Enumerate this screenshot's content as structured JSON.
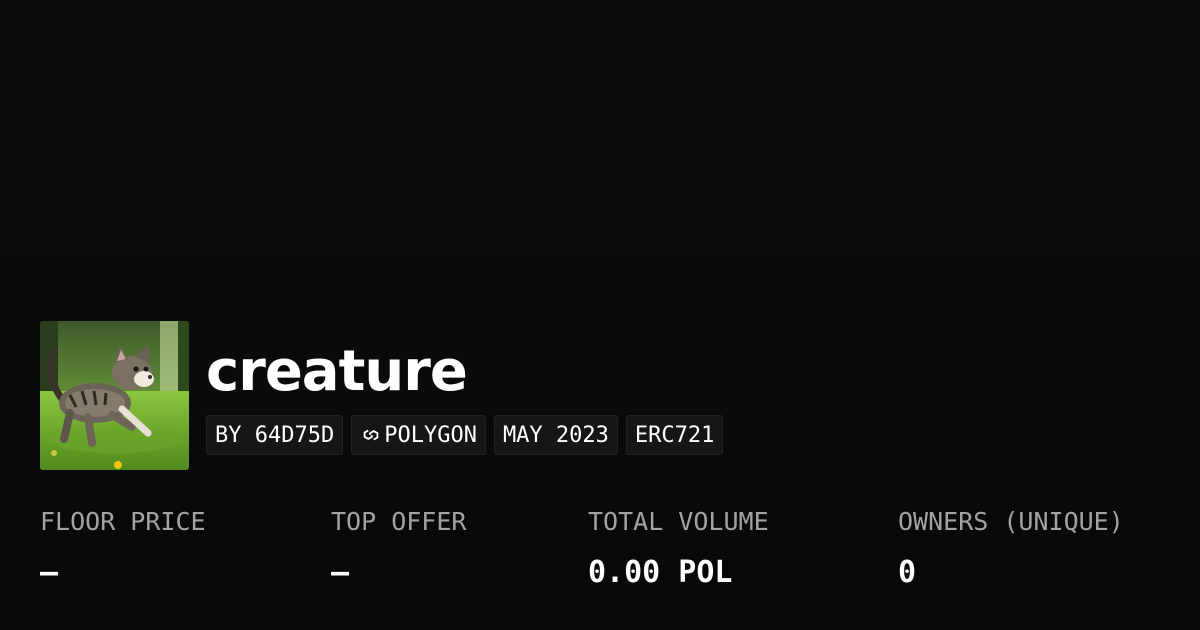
{
  "collection": {
    "name": "creature",
    "image_alt": "kitten walking on grass"
  },
  "badges": [
    {
      "label": "BY 64D75D",
      "icon": ""
    },
    {
      "label": "POLYGON",
      "icon": "polygon-chain-icon"
    },
    {
      "label": "MAY 2023",
      "icon": ""
    },
    {
      "label": "ERC721",
      "icon": ""
    }
  ],
  "stats": [
    {
      "label": "FLOOR PRICE",
      "value": "–"
    },
    {
      "label": "TOP OFFER",
      "value": "–"
    },
    {
      "label": "TOTAL VOLUME",
      "value": "0.00 POL"
    },
    {
      "label": "OWNERS (UNIQUE)",
      "value": "0"
    }
  ],
  "colors": {
    "background": "#0b0b0b",
    "text": "#ffffff",
    "muted": "#a3a3a3",
    "badge_bg": "#161616"
  }
}
